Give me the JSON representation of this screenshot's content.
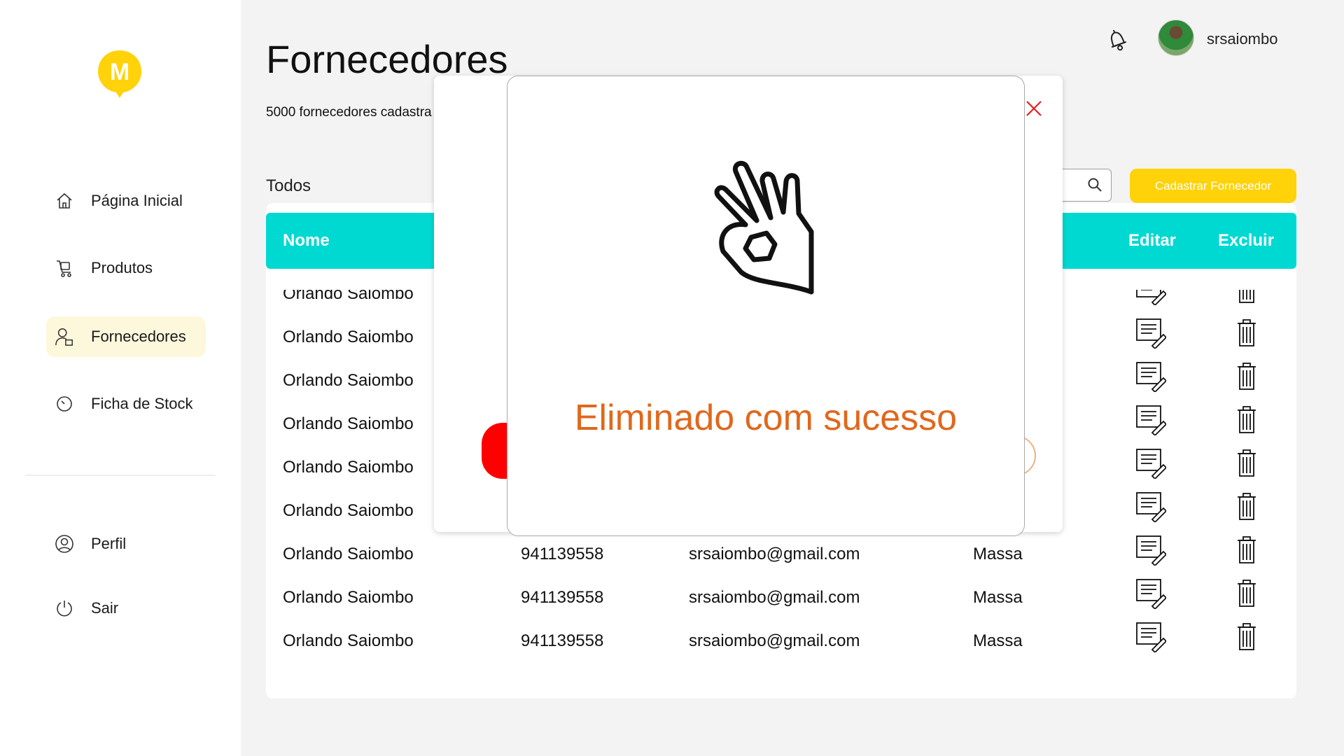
{
  "app": {
    "logo_letter": "M"
  },
  "sidebar": {
    "items": [
      {
        "label": "Página Inicial",
        "icon": "home-icon"
      },
      {
        "label": "Produtos",
        "icon": "cart-icon"
      },
      {
        "label": "Fornecedores",
        "icon": "supplier-icon",
        "active": true
      },
      {
        "label": "Ficha de Stock",
        "icon": "clock-icon"
      }
    ],
    "bottom_items": [
      {
        "label": "Perfil",
        "icon": "profile-icon"
      },
      {
        "label": "Sair",
        "icon": "power-icon"
      }
    ]
  },
  "header": {
    "title": "Fornecedores",
    "subtitle": "5000 fornecedores cadastra",
    "username": "srsaiombo"
  },
  "toolbar": {
    "filter_label": "Todos",
    "search_placeholder": "",
    "add_button_label": "Cadastrar  Fornecedor"
  },
  "table": {
    "columns": [
      "Nome",
      "Editar",
      "Excluir"
    ],
    "rows": [
      {
        "name": "Orlando Saiombo",
        "phone": "",
        "email": "",
        "type": ""
      },
      {
        "name": "Orlando Saiombo",
        "phone": "",
        "email": "",
        "type": ""
      },
      {
        "name": "Orlando Saiombo",
        "phone": "",
        "email": "",
        "type": ""
      },
      {
        "name": "Orlando Saiombo",
        "phone": "",
        "email": "",
        "type": ""
      },
      {
        "name": "Orlando Saiombo",
        "phone": "",
        "email": "",
        "type": ""
      },
      {
        "name": "Orlando Saiombo",
        "phone": "",
        "email": "",
        "type": ""
      },
      {
        "name": "Orlando Saiombo",
        "phone": "941139558",
        "email": "srsaiombo@gmail.com",
        "type": "Massa"
      },
      {
        "name": "Orlando Saiombo",
        "phone": "941139558",
        "email": "srsaiombo@gmail.com",
        "type": "Massa"
      },
      {
        "name": "Orlando Saiombo",
        "phone": "941139558",
        "email": "srsaiombo@gmail.com",
        "type": "Massa"
      }
    ]
  },
  "modal": {
    "message": "Eliminado com sucesso",
    "icon": "ok-hand-icon"
  },
  "colors": {
    "accent_yellow": "#ffd20a",
    "table_header": "#00d9d2",
    "success_text": "#e0681c",
    "close_red": "#e02020"
  }
}
